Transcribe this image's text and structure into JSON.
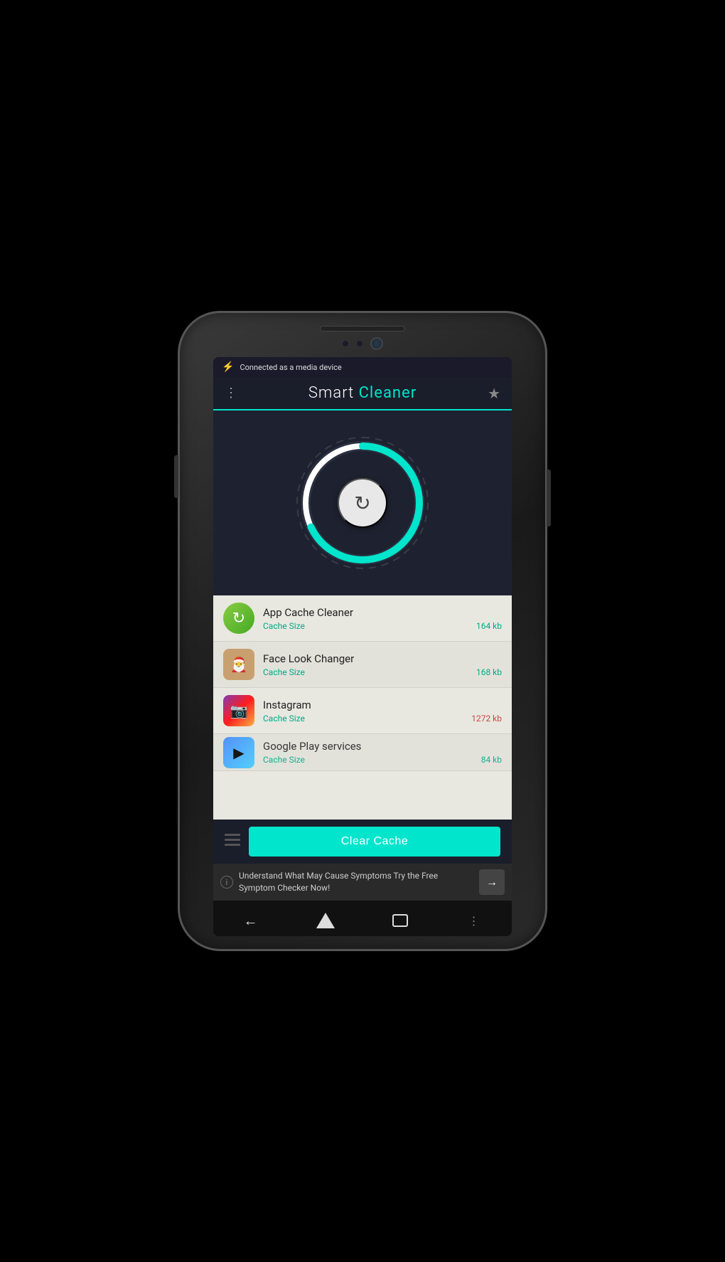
{
  "device": {
    "status_bar": {
      "usb_icon": "⚙",
      "connection_text": "Connected as a media device"
    }
  },
  "app": {
    "title_smart": "Smart ",
    "title_cleaner": "Cleaner",
    "menu_icon": "⋮",
    "star_icon": "★"
  },
  "gauge": {
    "refresh_icon": "↻"
  },
  "app_list": {
    "items": [
      {
        "name": "App Cache Cleaner",
        "cache_label": "Cache Size",
        "cache_size": "164 kb",
        "icon_type": "appcache"
      },
      {
        "name": "Face Look Changer",
        "cache_label": "Cache Size",
        "cache_size": "168 kb",
        "icon_type": "face"
      },
      {
        "name": "Instagram",
        "cache_label": "Cache Size",
        "cache_size": "1272 kb",
        "icon_type": "instagram"
      },
      {
        "name": "Google Play services",
        "cache_label": "Cache Size",
        "cache_size": "84 kb",
        "icon_type": "gplay"
      }
    ]
  },
  "bottom_bar": {
    "clear_cache_label": "Clear Cache",
    "list_icon": "≡"
  },
  "ad_banner": {
    "text": "Understand What May Cause Symptoms Try the Free Symptom Checker Now!",
    "info_icon": "i",
    "arrow_icon": "→"
  },
  "nav_bar": {
    "back_icon": "←",
    "menu_icon": "⋮"
  }
}
